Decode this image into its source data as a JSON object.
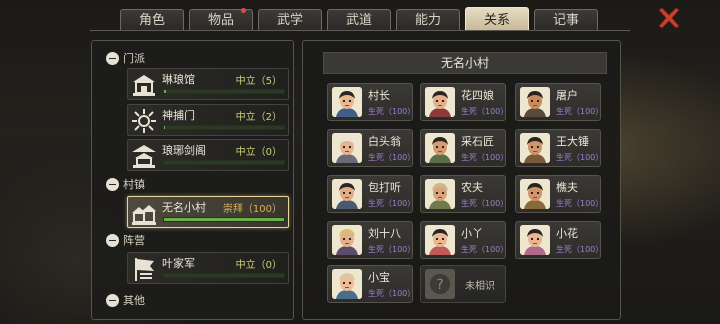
{
  "tabs": [
    {
      "label": "角色",
      "active": false,
      "dot": false
    },
    {
      "label": "物品",
      "active": false,
      "dot": true
    },
    {
      "label": "武学",
      "active": false,
      "dot": false
    },
    {
      "label": "武道",
      "active": false,
      "dot": false
    },
    {
      "label": "能力",
      "active": false,
      "dot": false
    },
    {
      "label": "关系",
      "active": true,
      "dot": false
    },
    {
      "label": "记事",
      "active": false,
      "dot": false
    }
  ],
  "left": {
    "sections": [
      {
        "title": "门派",
        "items": [
          {
            "name": "琳琅馆",
            "status": "中立（5）",
            "progress": 0.02,
            "emblem": "pavilion-emblem"
          },
          {
            "name": "神捕门",
            "status": "中立（2）",
            "progress": 0.01,
            "emblem": "sunburst-emblem"
          },
          {
            "name": "琅琊剑阁",
            "status": "中立（0）",
            "progress": 0.0,
            "emblem": "palace-emblem"
          }
        ]
      },
      {
        "title": "村镇",
        "items": [
          {
            "name": "无名小村",
            "status": "崇拜（100）",
            "progress": 1.0,
            "selected": true,
            "emblem": "village-emblem"
          }
        ]
      },
      {
        "title": "阵营",
        "items": [
          {
            "name": "叶家军",
            "status": "中立（0）",
            "progress": 0.0,
            "emblem": "banner-emblem"
          }
        ]
      },
      {
        "title": "其他",
        "items": []
      }
    ]
  },
  "right": {
    "title": "无名小村",
    "characters": [
      {
        "name": "村长",
        "stat": "生死（100）",
        "hair": "#2a2622",
        "skin": "#e8b98c",
        "cloth": "#3f5f8a"
      },
      {
        "name": "花四娘",
        "stat": "生死（100）",
        "hair": "#2e2620",
        "skin": "#e6b18a",
        "cloth": "#8a3a3a"
      },
      {
        "name": "屠户",
        "stat": "生死（100）",
        "hair": "#2b241e",
        "skin": "#c98a5e",
        "cloth": "#5a4a3a"
      },
      {
        "name": "白头翁",
        "stat": "生死（100）",
        "hair": "#e8e4dc",
        "skin": "#e6b48e",
        "cloth": "#6a6a7a"
      },
      {
        "name": "采石匠",
        "stat": "生死（100）",
        "hair": "#2a2420",
        "skin": "#d49b70",
        "cloth": "#5c6e4a"
      },
      {
        "name": "王大锤",
        "stat": "生死（100）",
        "hair": "#2a2420",
        "skin": "#cf9468",
        "cloth": "#7a5a3a"
      },
      {
        "name": "包打听",
        "stat": "生死（100）",
        "hair": "#2d2722",
        "skin": "#e2ad84",
        "cloth": "#4a5a6e"
      },
      {
        "name": "农夫",
        "stat": "生死（100）",
        "hair": "#c9b889",
        "skin": "#d9a27a",
        "cloth": "#6e7a4a"
      },
      {
        "name": "樵夫",
        "stat": "生死（100）",
        "hair": "#2a2420",
        "skin": "#cf946a",
        "cloth": "#8a6a3a"
      },
      {
        "name": "刘十八",
        "stat": "生死（100）",
        "hair": "#d8c070",
        "skin": "#e4b08a",
        "cloth": "#5a4e6a"
      },
      {
        "name": "小丫",
        "stat": "生死（100）",
        "hair": "#2c2420",
        "skin": "#eab992",
        "cloth": "#c25a5a"
      },
      {
        "name": "小花",
        "stat": "生死（100）",
        "hair": "#2a2420",
        "skin": "#e9b690",
        "cloth": "#b06a8a"
      },
      {
        "name": "小宝",
        "stat": "生死（100）",
        "hair": "#d8c9a6",
        "skin": "#edbd96",
        "cloth": "#4a6e8a"
      },
      {
        "name": "未相识",
        "stat": "",
        "unknown": true
      }
    ]
  },
  "colors": {
    "accent": "#e6d69a",
    "bar_fill": "#6bb14a",
    "stat_purple": "#9b7fd0",
    "neutral_green": "#c9d37a",
    "worship_gold": "#d7b15e",
    "close_red": "#c8402f"
  },
  "icons": {
    "close": "close-x-icon",
    "collapse": "minus-circle-icon"
  }
}
